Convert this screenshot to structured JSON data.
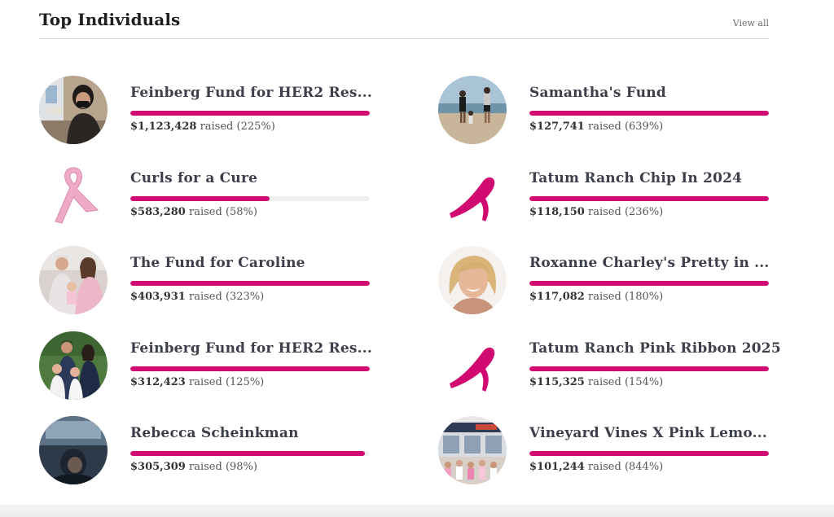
{
  "header": {
    "title": "Top Individuals",
    "view_all": "View all"
  },
  "raised_word": "raised",
  "accent_color": "#d10a72",
  "cards": [
    {
      "name": "Feinberg Fund for HER2 Res...",
      "amount": "$1,123,428",
      "pct": "(225%)",
      "progress": 1.0,
      "avatar": "photo-woman-masked-icon"
    },
    {
      "name": "Samantha's Fund",
      "amount": "$127,741",
      "pct": "(639%)",
      "progress": 1.0,
      "avatar": "photo-beach-family-icon"
    },
    {
      "name": "Curls for a Cure",
      "amount": "$583,280",
      "pct": "(58%)",
      "progress": 0.58,
      "avatar": "pink-ribbon-light-icon"
    },
    {
      "name": "Tatum Ranch Chip In 2024",
      "amount": "$118,150",
      "pct": "(236%)",
      "progress": 1.0,
      "avatar": "pink-ribbon-icon"
    },
    {
      "name": "The Fund for Caroline",
      "amount": "$403,931",
      "pct": "(323%)",
      "progress": 1.0,
      "avatar": "photo-family-icon"
    },
    {
      "name": "Roxanne Charley's Pretty in ...",
      "amount": "$117,082",
      "pct": "(180%)",
      "progress": 1.0,
      "avatar": "photo-woman-portrait-icon"
    },
    {
      "name": "Feinberg Fund for HER2 Res...",
      "amount": "$312,423",
      "pct": "(125%)",
      "progress": 1.0,
      "avatar": "photo-family-outdoor-icon"
    },
    {
      "name": "Tatum Ranch Pink Ribbon 2025",
      "amount": "$115,325",
      "pct": "(154%)",
      "progress": 1.0,
      "avatar": "pink-ribbon-icon"
    },
    {
      "name": "Rebecca Scheinkman",
      "amount": "$305,309",
      "pct": "(98%)",
      "progress": 0.98,
      "avatar": "photo-dark-selfie-icon"
    },
    {
      "name": "Vineyard Vines X Pink Lemo...",
      "amount": "$101,244",
      "pct": "(844%)",
      "progress": 1.0,
      "avatar": "photo-storefront-group-icon"
    }
  ]
}
